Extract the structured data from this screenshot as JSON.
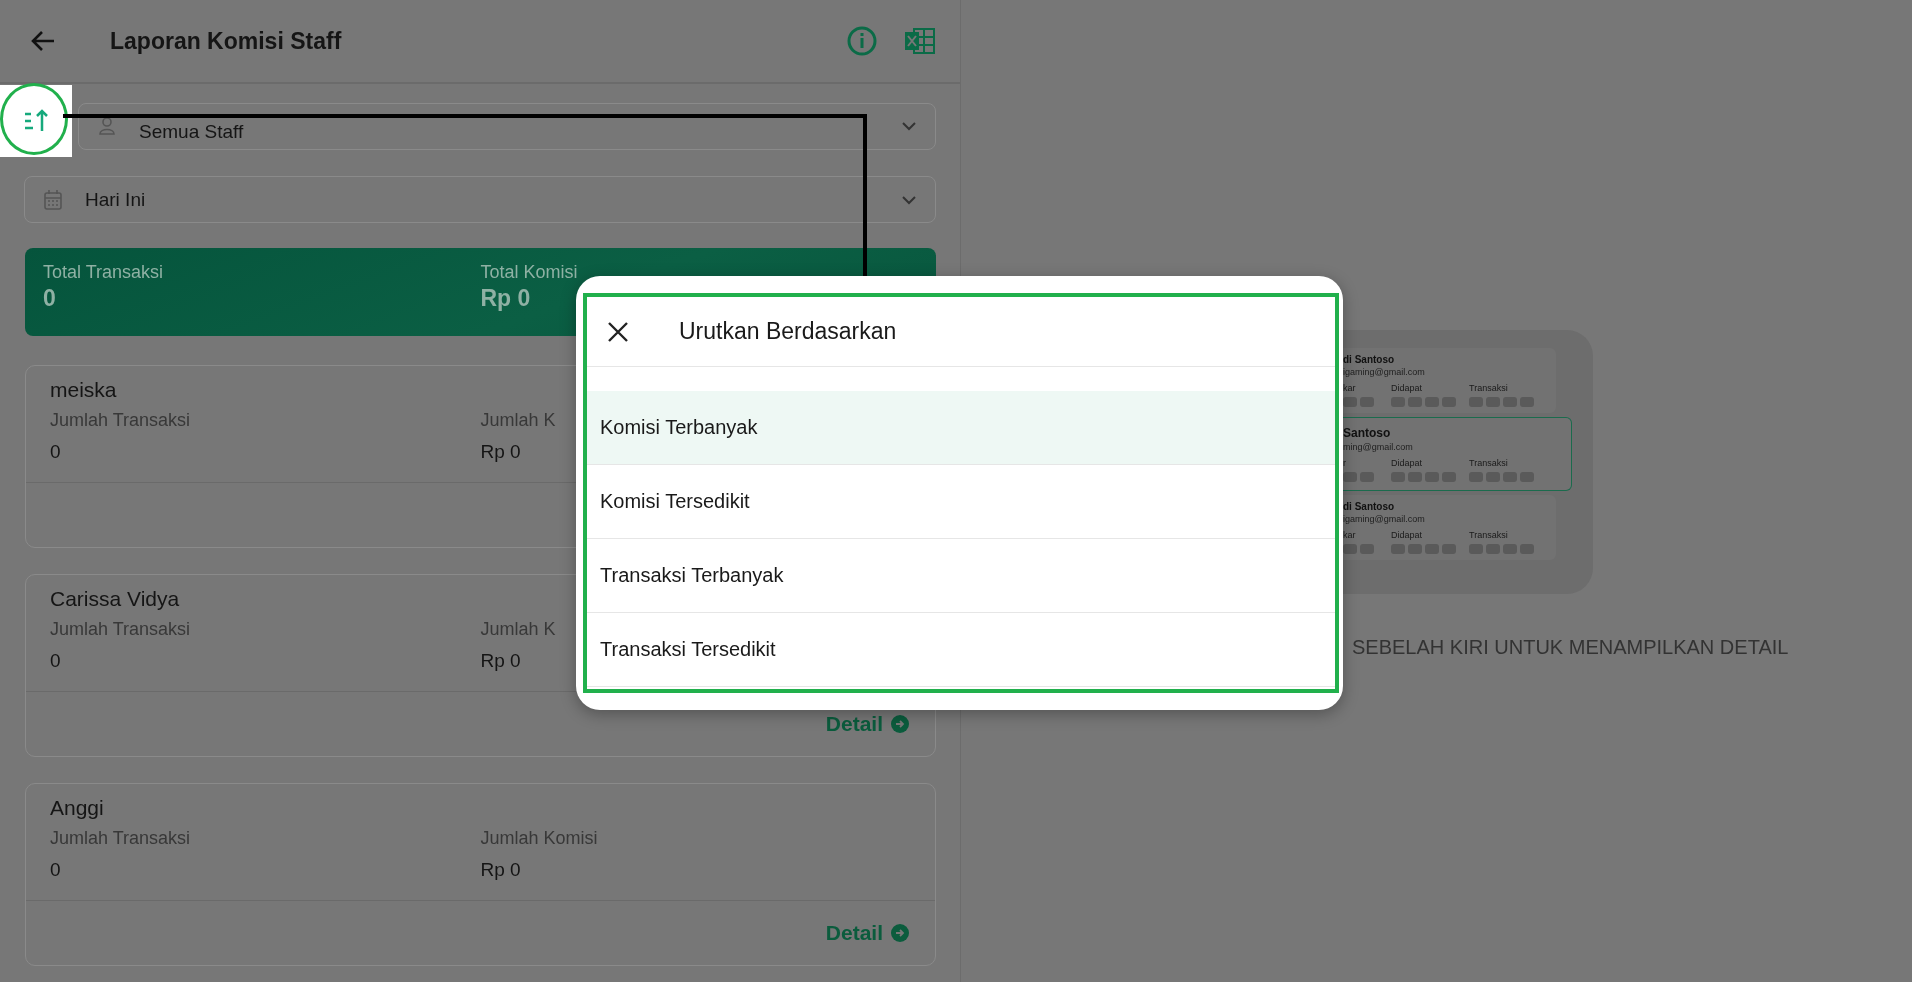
{
  "header": {
    "title": "Laporan Komisi Staff"
  },
  "filters": [
    {
      "kind": "staff",
      "value": "Semua Staff"
    },
    {
      "kind": "date",
      "value": "Hari Ini"
    }
  ],
  "summary": [
    {
      "label": "Total Transaksi",
      "value": "0"
    },
    {
      "label": "Total Komisi",
      "value": "Rp 0"
    }
  ],
  "staff": [
    {
      "name": "meiska",
      "transaksi_label": "Jumlah Transaksi",
      "transaksi": "0",
      "komisi_label": "Jumlah K",
      "komisi": "Rp 0"
    },
    {
      "name": "Carissa Vidya",
      "transaksi_label": "Jumlah Transaksi",
      "transaksi": "0",
      "komisi_label": "Jumlah K",
      "komisi": "Rp 0",
      "detail": "Detail"
    },
    {
      "name": "Anggi",
      "transaksi_label": "Jumlah Transaksi",
      "transaksi": "0",
      "komisi_label": "Jumlah Komisi",
      "komisi": "Rp 0",
      "detail": "Detail"
    }
  ],
  "sort_dialog": {
    "title": "Urutkan Berdasarkan",
    "options": [
      {
        "label": "Komisi Terbanyak",
        "selected": true
      },
      {
        "label": "Komisi Tersedikit",
        "selected": false
      },
      {
        "label": "Transaksi Terbanyak",
        "selected": false
      },
      {
        "label": "Transaksi Tersedikit",
        "selected": false
      }
    ]
  },
  "illustration_cards": [
    {
      "name": "di Santoso",
      "email": "igaming@gmail.com",
      "labels": [
        "kar",
        "Didapat",
        "Transaksi"
      ],
      "selected": false
    },
    {
      "name": "Santoso",
      "email": "ming@gmail.com",
      "labels": [
        "r",
        "Didapat",
        "Transaksi"
      ],
      "selected": true
    },
    {
      "name": "di Santoso",
      "email": "igaming@gmail.com",
      "labels": [
        "kar",
        "Didapat",
        "Transaksi"
      ],
      "selected": false
    }
  ],
  "detail_hint": "SEBELAH KIRI UNTUK MENAMPILKAN DETAIL"
}
